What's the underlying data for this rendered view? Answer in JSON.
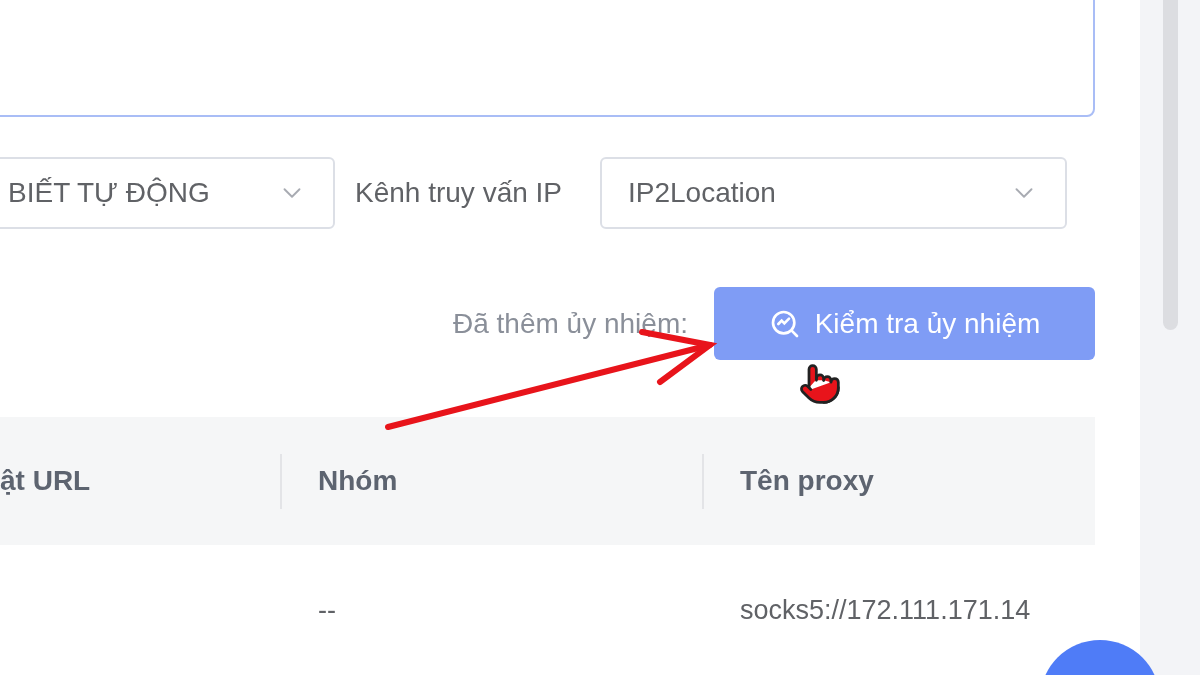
{
  "filters": [
    {
      "kind": "select",
      "value": "BIẾT TỰ ĐỘNG"
    },
    {
      "kind": "label",
      "text": "Kênh truy vấn IP"
    },
    {
      "kind": "select",
      "value": "IP2Location"
    }
  ],
  "status_text": "Đã thêm ủy nhiệm:",
  "check_button": {
    "label": "Kiểm tra ủy nhiệm"
  },
  "table": {
    "columns": [
      "ật URL",
      "Nhóm",
      "Tên proxy"
    ],
    "rows": [
      {
        "group": "--",
        "proxy_name": "socks5://172.111.171.14"
      }
    ]
  }
}
